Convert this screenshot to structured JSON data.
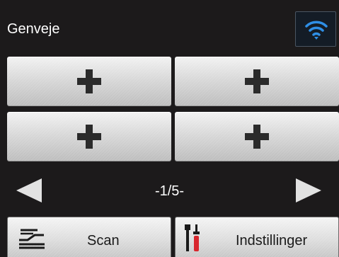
{
  "header": {
    "title": "Genveje",
    "wifi_icon": "wifi-icon"
  },
  "shortcuts": [
    {
      "label": "+",
      "icon": "plus-icon"
    },
    {
      "label": "+",
      "icon": "plus-icon"
    },
    {
      "label": "+",
      "icon": "plus-icon"
    },
    {
      "label": "+",
      "icon": "plus-icon"
    }
  ],
  "pagination": {
    "indicator": "-1/5-",
    "prev_icon": "arrow-left-icon",
    "next_icon": "arrow-right-icon"
  },
  "bottom_bar": {
    "scan_label": "Scan",
    "scan_icon": "scan-icon",
    "settings_label": "Indstillinger",
    "settings_icon": "tools-icon"
  },
  "colors": {
    "background": "#1c1a1b",
    "wifi": "#2f8fe6",
    "tile": "#d9d9d9",
    "plus": "#2b2b2b",
    "tool_red": "#d8262d"
  }
}
